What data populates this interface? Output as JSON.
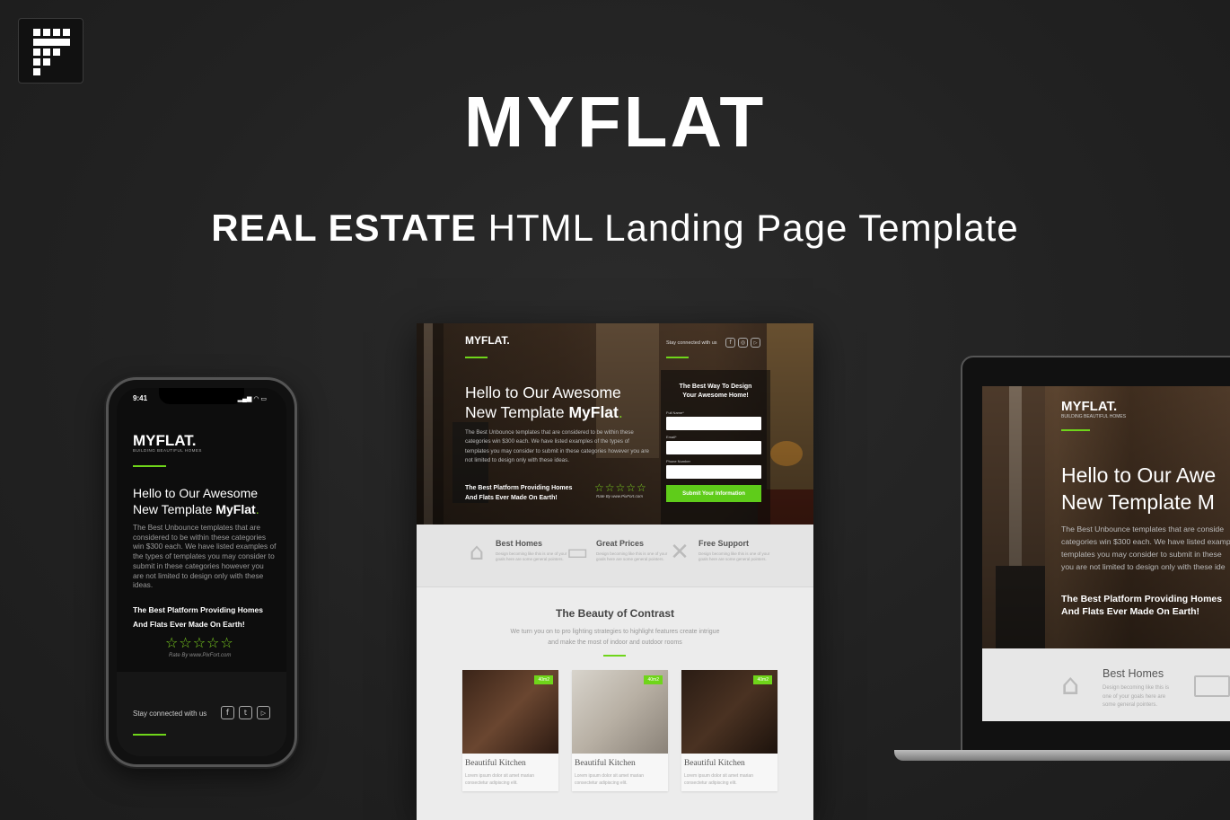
{
  "brand": {
    "title": "MYFLAT",
    "subtitle_bold": "REAL ESTATE",
    "subtitle_rest": " HTML Landing Page Template"
  },
  "colors": {
    "background": "#232323",
    "accent": "#6fd51a"
  },
  "phone": {
    "time": "9:41",
    "logo": "MYFLAT.",
    "logo_sub": "BUILDING BEAUTIFUL HOMES",
    "heading_1": "Hello to Our Awesome",
    "heading_2a": "New Template ",
    "heading_2b": "MyFlat",
    "heading_dot": ".",
    "text": "The Best Unbounce templates that are considered to be within these categories win $300 each. We have listed examples of the types of templates you may consider to submit in these categories however you are not limited to design only with these ideas.",
    "best_1": "The Best Platform Providing Homes",
    "best_2": "And Flats Ever Made On Earth!",
    "stars": "☆☆☆☆☆",
    "rate": "Rate By www.PixFort.com",
    "stay": "Stay connected with us"
  },
  "center": {
    "logo": "MYFLAT.",
    "stay": "Stay connected with us",
    "heading_1": "Hello to Our Awesome",
    "heading_2a": "New Template ",
    "heading_2b": "MyFlat",
    "heading_dot": ".",
    "text": "The Best Unbounce templates that are considered to be within these categories win $300 each. We have listed examples of the types of templates you may consider to submit in these categories however you are not limited to design only with these ideas.",
    "best_1": "The Best Platform Providing Homes",
    "best_2": "And Flats Ever Made On Earth!",
    "stars": "☆☆☆☆☆",
    "rate": "Rate By www.PixFort.com",
    "form": {
      "heading_1": "The Best Way To Design",
      "heading_2": "Your Awesome Home!",
      "label_name": "Full Name*",
      "label_email": "Email*",
      "label_phone": "Phone Number",
      "submit": "Submit Your Information"
    },
    "features": [
      {
        "title": "Best Homes",
        "desc": "Design becoming like this is one of your goals here are some general pointers.",
        "icon": "house-icon"
      },
      {
        "title": "Great Prices",
        "desc": "Design becoming like this is one of your goals here are some general pointers.",
        "icon": "credit-card-icon"
      },
      {
        "title": "Free Support",
        "desc": "Design becoming like this is one of your goals here are some general pointers.",
        "icon": "tools-icon"
      }
    ],
    "beauty_title": "The Beauty of Contrast",
    "beauty_desc": "We turn you on to pro lighting strategies to highlight features create intrigue and make the most of indoor and outdoor rooms",
    "cards": [
      {
        "tag": "40m2",
        "title": "Beautiful Kitchen",
        "desc": "Lorem ipsum dolor sit amet marian consectetur adipiscing elit."
      },
      {
        "tag": "40m2",
        "title": "Beautiful Kitchen",
        "desc": "Lorem ipsum dolor sit amet marian consectetur adipiscing elit."
      },
      {
        "tag": "40m2",
        "title": "Beautiful Kitchen",
        "desc": "Lorem ipsum dolor sit amet marian consectetur adipiscing elit."
      }
    ]
  },
  "laptop": {
    "logo": "MYFLAT.",
    "logo_sub": "BUILDING BEAUTIFUL HOMES",
    "heading_1": "Hello to Our Awe",
    "heading_2": "New Template M",
    "text": "The Best Unbounce templates that are conside categories win $300 each. We have listed examp templates you may consider to submit in these you are not limited to design only with these ide",
    "best_1": "The Best Platform Providing Homes",
    "best_2": "And Flats Ever Made On Earth!",
    "feature_title": "Best Homes",
    "feature_desc": "Design becoming like this is one of your goals here are some general pointers."
  }
}
